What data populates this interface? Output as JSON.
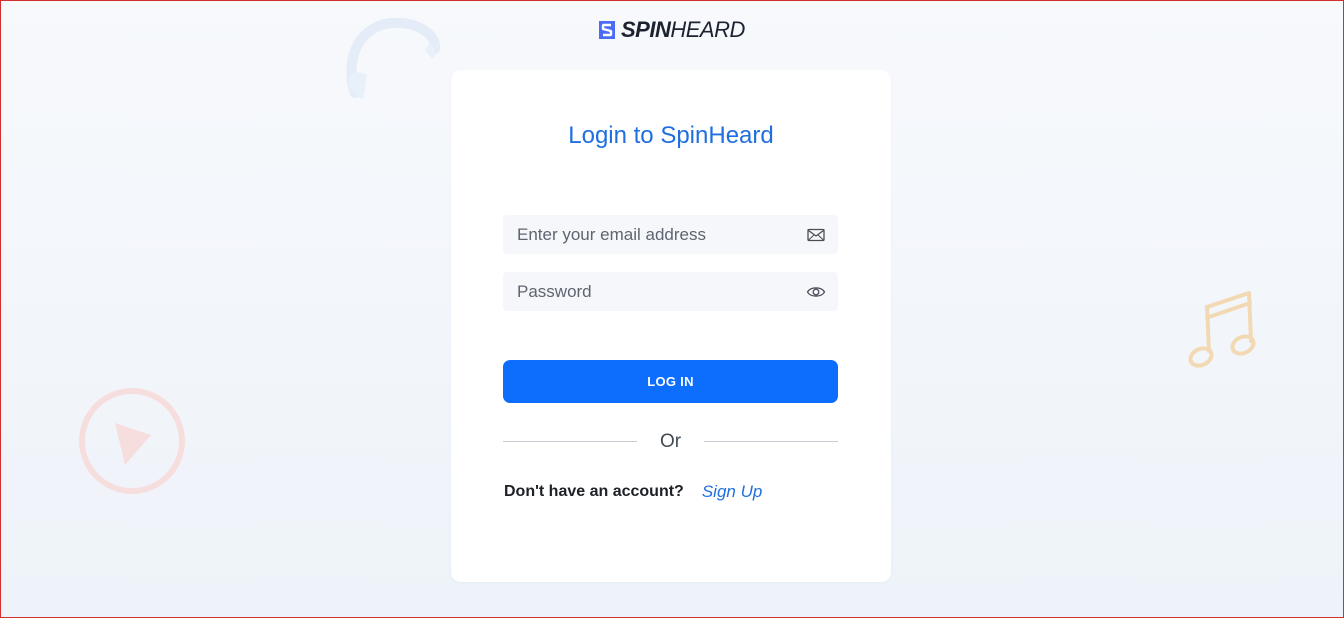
{
  "logo": {
    "bold_text": "SPIN",
    "light_text": "HEARD",
    "brand_color": "#4a6cf7"
  },
  "login_card": {
    "title": "Login to SpinHeard",
    "email": {
      "placeholder": "Enter your email address",
      "value": "",
      "icon": "envelope-icon"
    },
    "password": {
      "placeholder": "Password",
      "value": "",
      "icon": "eye-icon"
    },
    "login_button_label": "LOG IN",
    "divider_text": "Or",
    "signup_prompt": "Don't have an account?",
    "signup_link": "Sign Up"
  },
  "colors": {
    "accent": "#0d6efd",
    "title": "#1f6fe0",
    "deco_headphones": "#dfe9f6",
    "deco_play": "#f6dcdc",
    "deco_music": "#f3d9b3"
  }
}
